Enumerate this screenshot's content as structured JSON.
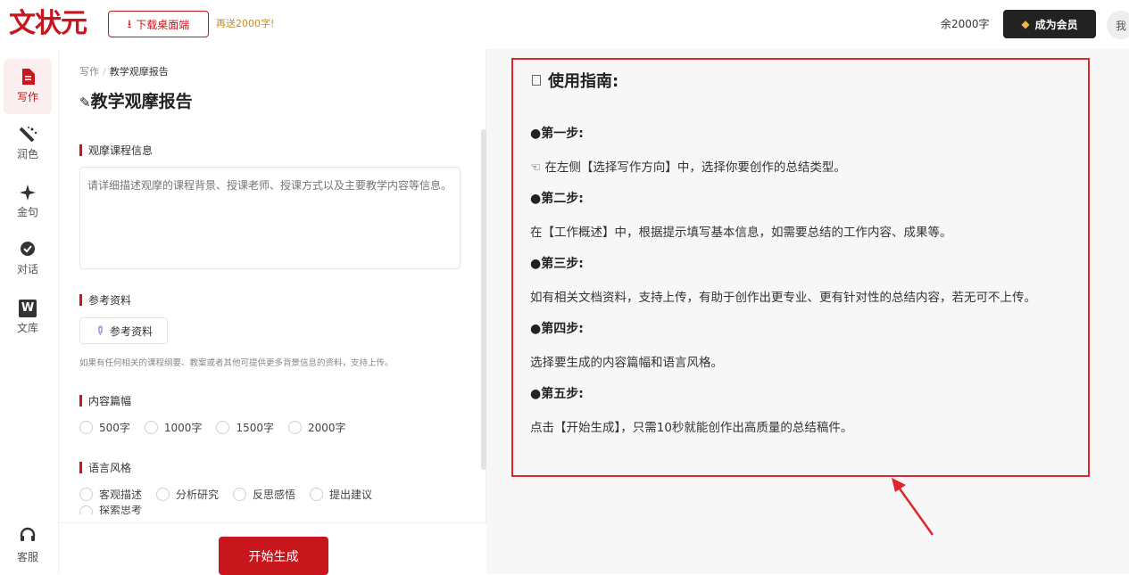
{
  "header": {
    "logo": "文状元",
    "download_label": "下载桌面端",
    "bonus_text": "再送2000字!",
    "words_left": "余2000字",
    "vip_label": "成为会员",
    "avatar_text": "我"
  },
  "nav": {
    "items": [
      {
        "label": "写作",
        "icon": "document-icon",
        "active": true
      },
      {
        "label": "润色",
        "icon": "magic-wand-icon"
      },
      {
        "label": "金句",
        "icon": "sparkle-icon"
      },
      {
        "label": "对话",
        "icon": "chat-icon"
      },
      {
        "label": "文库",
        "icon": "w-library-icon"
      }
    ],
    "service_label": "客服"
  },
  "form": {
    "breadcrumb": [
      "写作",
      "教学观摩报告"
    ],
    "title": "教学观摩报告",
    "section_course": "观摩课程信息",
    "course_placeholder": "请详细描述观摩的课程背景、授课老师、授课方式以及主要教学内容等信息。",
    "section_reference": "参考资料",
    "reference_button": "参考资料",
    "reference_hint": "如果有任何相关的课程纲要、教案或者其他可提供更多背景信息的资料，支持上传。",
    "section_length": "内容篇幅",
    "length_options": [
      "500字",
      "1000字",
      "1500字",
      "2000字"
    ],
    "section_style": "语言风格",
    "style_options": [
      "客观描述",
      "分析研究",
      "反思感悟",
      "提出建议"
    ],
    "style_cut_option": "探索思考",
    "start_button": "开始生成"
  },
  "guide": {
    "title": "使用指南:",
    "steps": [
      {
        "heading": "●第一步:",
        "text": "☜ 在左侧【选择写作方向】中，选择你要创作的总结类型。"
      },
      {
        "heading": "●第二步:",
        "text": "在【工作概述】中，根据提示填写基本信息，如需要总结的工作内容、成果等。"
      },
      {
        "heading": "●第三步:",
        "text": "如有相关文档资料，支持上传，有助于创作出更专业、更有针对性的总结内容，若无可不上传。"
      },
      {
        "heading": "●第四步:",
        "text": "选择要生成的内容篇幅和语言风格。"
      },
      {
        "heading": "●第五步:",
        "text": "点击【开始生成】，只需10秒就能创作出高质量的总结稿件。"
      }
    ]
  },
  "colors": {
    "brand": "#c8161d",
    "annotation": "#e0262d"
  }
}
